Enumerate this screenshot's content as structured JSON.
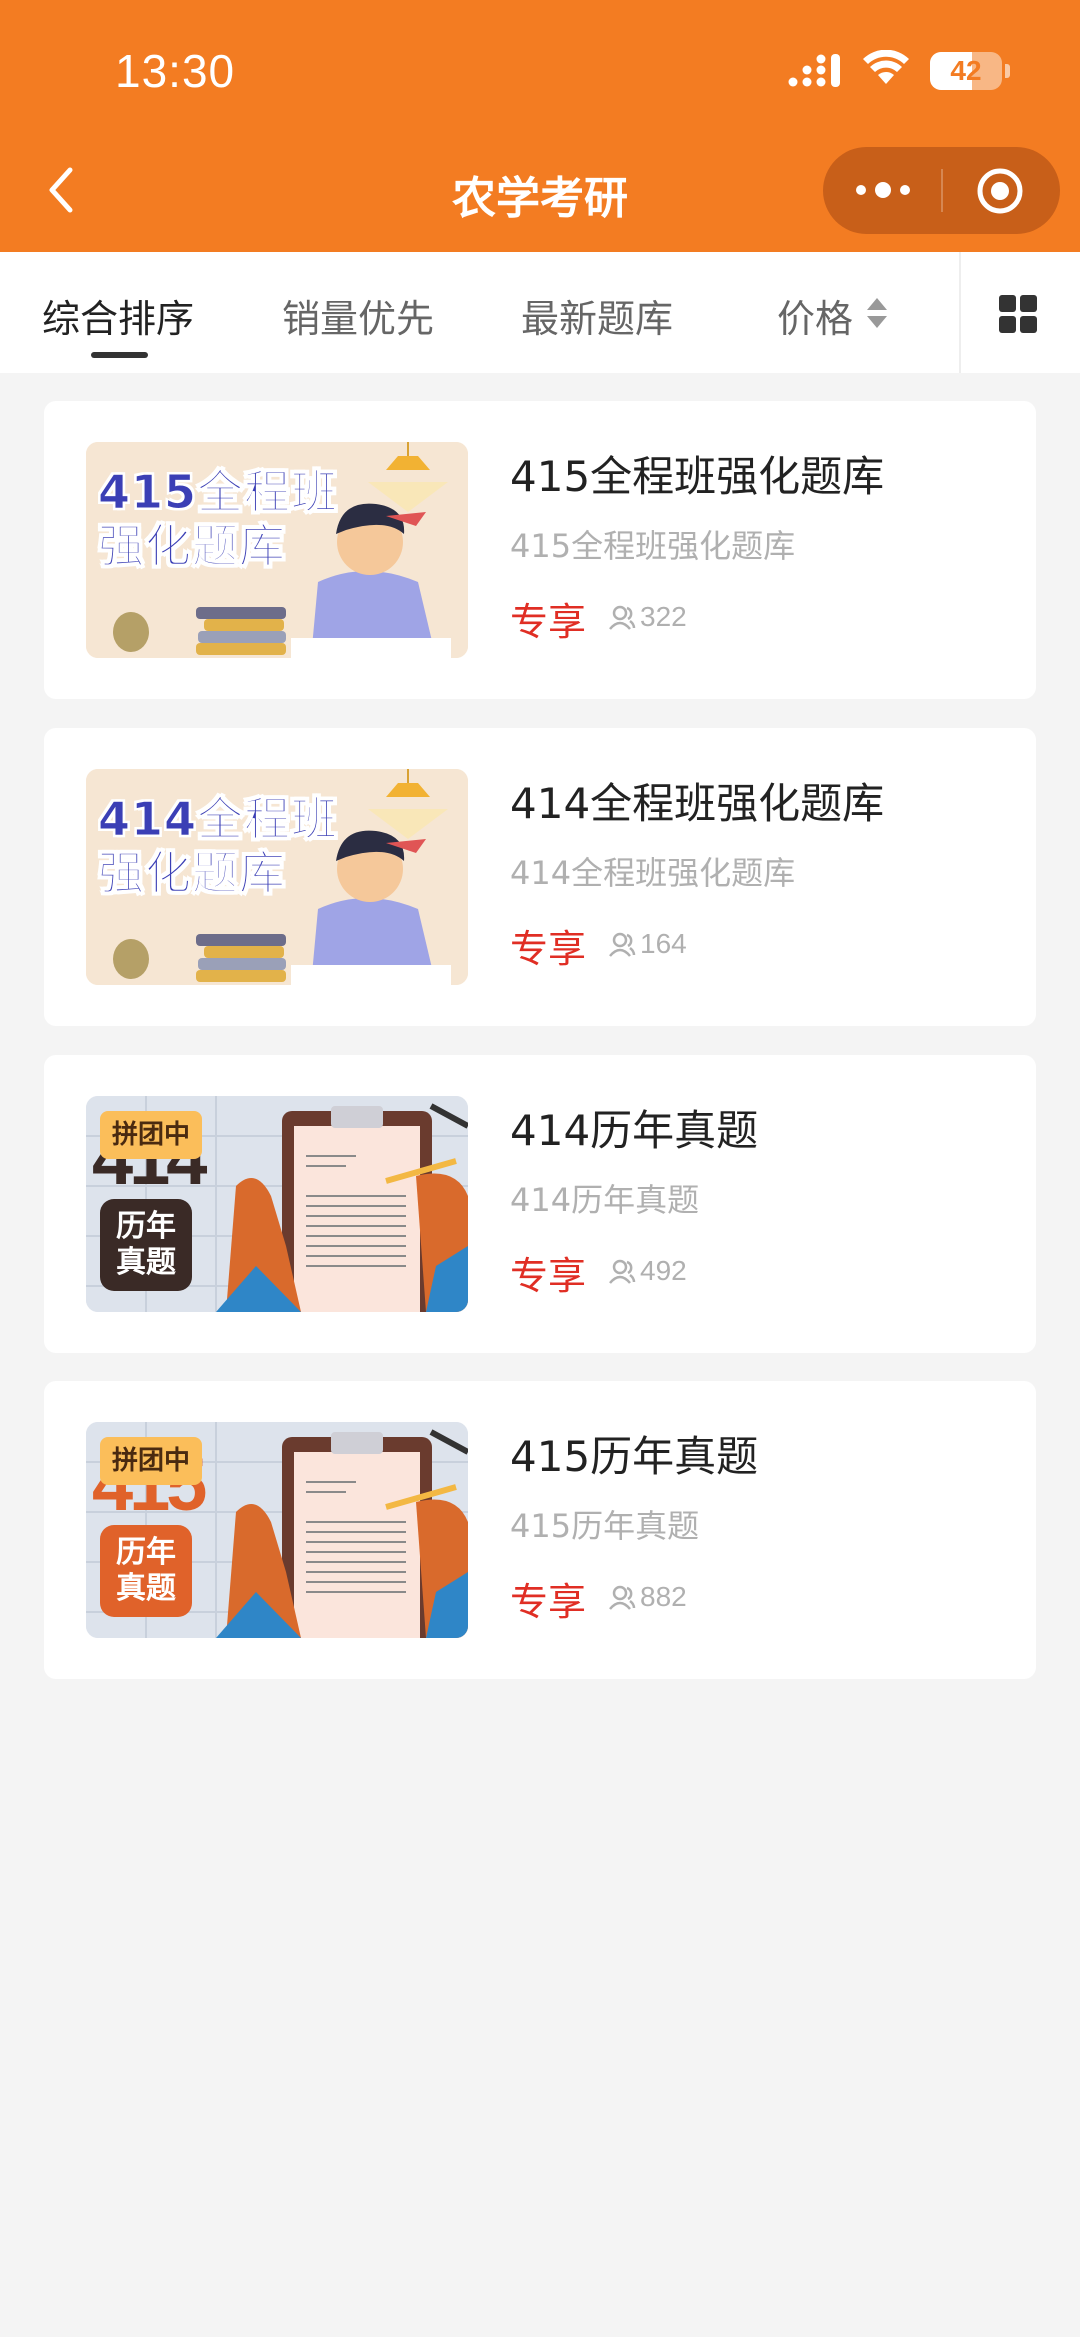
{
  "status": {
    "time": "13:30",
    "battery": "42"
  },
  "nav": {
    "title": "农学考研"
  },
  "sort": {
    "items": [
      "综合排序",
      "销量优先",
      "最新题库",
      "价格"
    ],
    "active": "综合排序"
  },
  "products": [
    {
      "title": "415全程班强化题库",
      "subtitle": "415全程班强化题库",
      "tag": "专享",
      "count": "322",
      "thumb_text": [
        "415全程班",
        "强化题库"
      ]
    },
    {
      "title": "414全程班强化题库",
      "subtitle": "414全程班强化题库",
      "tag": "专享",
      "count": "164",
      "thumb_text": [
        "414全程班",
        "强化题库"
      ]
    },
    {
      "title": "414历年真题",
      "subtitle": "414历年真题",
      "tag": "专享",
      "count": "492",
      "thumb_badge": "拼团中",
      "thumb_number": "414",
      "thumb_box": [
        "历年",
        "真题"
      ]
    },
    {
      "title": "415历年真题",
      "subtitle": "415历年真题",
      "tag": "专享",
      "count": "882",
      "thumb_badge": "拼团中",
      "thumb_number": "415",
      "thumb_box": [
        "历年",
        "真题"
      ]
    }
  ],
  "colors": {
    "brand": "#f37c22",
    "price_red": "#e02e24"
  }
}
